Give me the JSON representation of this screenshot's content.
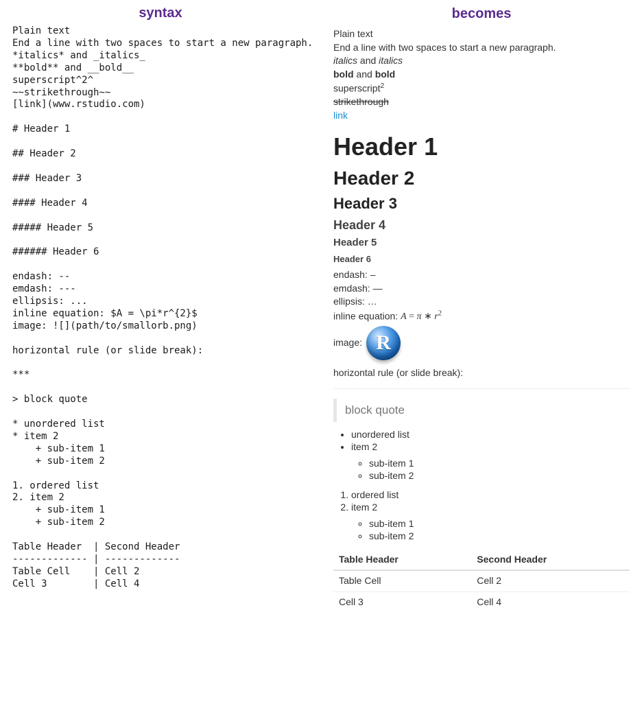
{
  "titles": {
    "left": "syntax",
    "right": "becomes"
  },
  "syntax_lines": [
    "Plain text",
    "End a line with two spaces to start a new paragraph.",
    "*italics* and _italics_",
    "**bold** and __bold__",
    "superscript^2^",
    "~~strikethrough~~",
    "[link](www.rstudio.com)",
    "",
    "# Header 1",
    "",
    "## Header 2",
    "",
    "### Header 3",
    "",
    "#### Header 4",
    "",
    "##### Header 5",
    "",
    "###### Header 6",
    "",
    "endash: --",
    "emdash: ---",
    "ellipsis: ...",
    "inline equation: $A = \\pi*r^{2}$",
    "image: ![](path/to/smallorb.png)",
    "",
    "horizontal rule (or slide break):",
    "",
    "***",
    "",
    "> block quote",
    "",
    "* unordered list",
    "* item 2",
    "    + sub-item 1",
    "    + sub-item 2",
    "",
    "1. ordered list",
    "2. item 2",
    "    + sub-item 1",
    "    + sub-item 2",
    "",
    "Table Header  | Second Header",
    "------------- | -------------",
    "Table Cell    | Cell 2",
    "Cell 3        | Cell 4"
  ],
  "rendered": {
    "plain1": "Plain text",
    "plain2": "End a line with two spaces to start a new paragraph.",
    "italics": "italics",
    "and": " and ",
    "bold": "bold",
    "super_label": "superscript",
    "super_exp": "2",
    "strike": "strikethrough",
    "link_text": "link",
    "headers": {
      "h1": "Header 1",
      "h2": "Header 2",
      "h3": "Header 3",
      "h4": "Header 4",
      "h5": "Header 5",
      "h6": "Header 6"
    },
    "endash_label": "endash: ",
    "endash_char": "–",
    "emdash_label": "emdash: ",
    "emdash_char": "—",
    "ellipsis_label": "ellipsis: ",
    "ellipsis_char": "…",
    "eq_label": "inline equation: ",
    "eq_A": "A",
    "eq_eq": " = ",
    "eq_pi": "π",
    "eq_star": " ∗ ",
    "eq_r": "r",
    "eq_exp": "2",
    "image_label": "image: ",
    "hr_label": "horizontal rule (or slide break):",
    "blockquote": "block quote",
    "ul1": "unordered list",
    "ul2": "item 2",
    "ul_sub1": "sub-item 1",
    "ul_sub2": "sub-item 2",
    "ol1": "ordered list",
    "ol2": "item 2",
    "ol_sub1": "sub-item 1",
    "ol_sub2": "sub-item 2",
    "table": {
      "headers": [
        "Table Header",
        "Second Header"
      ],
      "rows": [
        [
          "Table Cell",
          "Cell 2"
        ],
        [
          "Cell 3",
          "Cell 4"
        ]
      ]
    }
  }
}
